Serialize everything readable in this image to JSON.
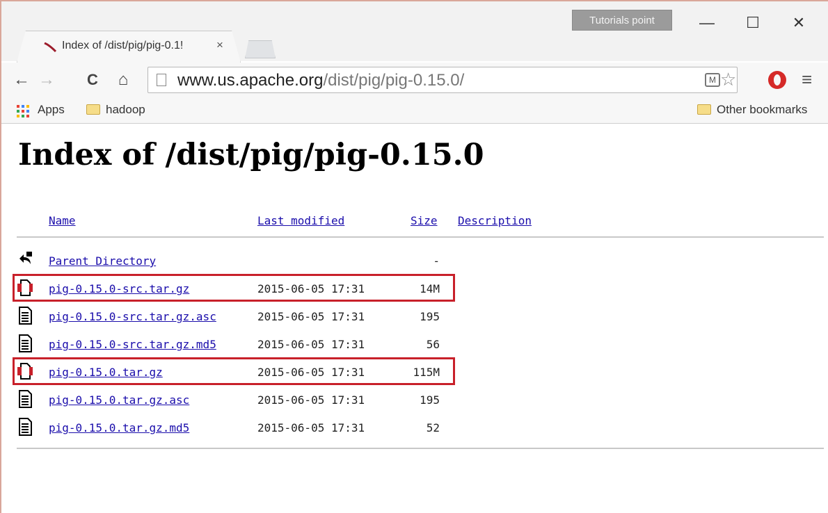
{
  "browser": {
    "tab_title": "Index of /dist/pig/pig-0.1!",
    "tab_close": "×",
    "profile_badge": "Tutorials point",
    "window_controls": {
      "minimize": "—",
      "maximize": "☐",
      "close": "✕"
    },
    "nav": {
      "back": "←",
      "forward": "→",
      "reload": "C",
      "home": "⌂"
    },
    "url_host": "www.us.apache.org",
    "url_path": "/dist/pig/pig-0.15.0/",
    "star": "☆",
    "menu": "≡",
    "icons": [
      "page-icon",
      "ext-icon",
      "star-icon",
      "opera-icon",
      "menu-icon",
      "apps-icon",
      "folder-icon"
    ]
  },
  "bookmarks": {
    "apps": "Apps",
    "hadoop": "hadoop",
    "other": "Other bookmarks"
  },
  "page": {
    "title": "Index of /dist/pig/pig-0.15.0",
    "columns": {
      "name": "Name",
      "last_modified": "Last modified",
      "size": "Size",
      "description": "Description"
    },
    "parent": {
      "name": "Parent Directory",
      "size": "-"
    },
    "files": [
      {
        "name": "pig-0.15.0-src.tar.gz",
        "date": "2015-06-05 17:31",
        "size": "14M",
        "icon": "archive-icon",
        "highlighted": true
      },
      {
        "name": "pig-0.15.0-src.tar.gz.asc",
        "date": "2015-06-05 17:31",
        "size": "195",
        "icon": "text-file-icon",
        "highlighted": false
      },
      {
        "name": "pig-0.15.0-src.tar.gz.md5",
        "date": "2015-06-05 17:31",
        "size": "56",
        "icon": "text-file-icon",
        "highlighted": false
      },
      {
        "name": "pig-0.15.0.tar.gz",
        "date": "2015-06-05 17:31",
        "size": "115M",
        "icon": "archive-icon",
        "highlighted": true
      },
      {
        "name": "pig-0.15.0.tar.gz.asc",
        "date": "2015-06-05 17:31",
        "size": "195",
        "icon": "text-file-icon",
        "highlighted": false
      },
      {
        "name": "pig-0.15.0.tar.gz.md5",
        "date": "2015-06-05 17:31",
        "size": "52",
        "icon": "text-file-icon",
        "highlighted": false
      }
    ]
  },
  "colors": {
    "link": "#1a0dab",
    "highlight": "#c8202a"
  }
}
